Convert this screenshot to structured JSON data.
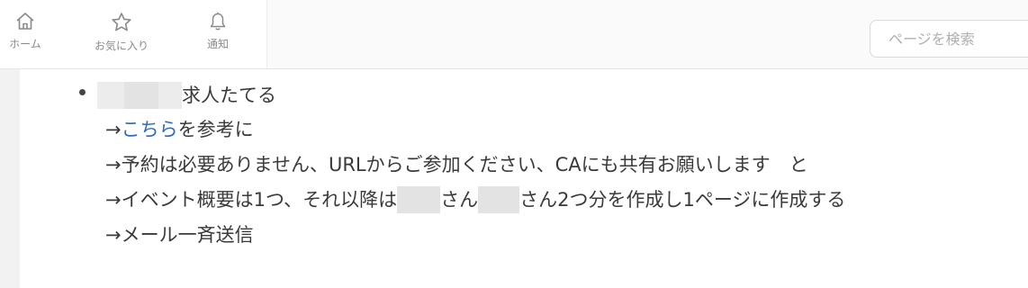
{
  "nav": {
    "items": [
      {
        "label": "ホーム",
        "icon": "home-icon"
      },
      {
        "label": "お気に入り",
        "icon": "star-icon"
      },
      {
        "label": "通知",
        "icon": "bell-icon"
      }
    ]
  },
  "search": {
    "placeholder": "ページを検索"
  },
  "content": {
    "line1_text": "求人たてる",
    "line2_arrow": "→",
    "line2_link": "こちら",
    "line2_rest": "を参考に",
    "line3": "→予約は必要ありません、URLからご参加ください、CAにも共有お願いします　と",
    "line4_a": "→イベント概要は1つ、それ以降は",
    "line4_b": "さん",
    "line4_c": "さん2つ分を作成し1ページに作成する",
    "line5": "→メール一斉送信"
  },
  "colors": {
    "link": "#2f6db5",
    "text": "#3a3a3a",
    "nav_label": "#8a8a8a"
  }
}
